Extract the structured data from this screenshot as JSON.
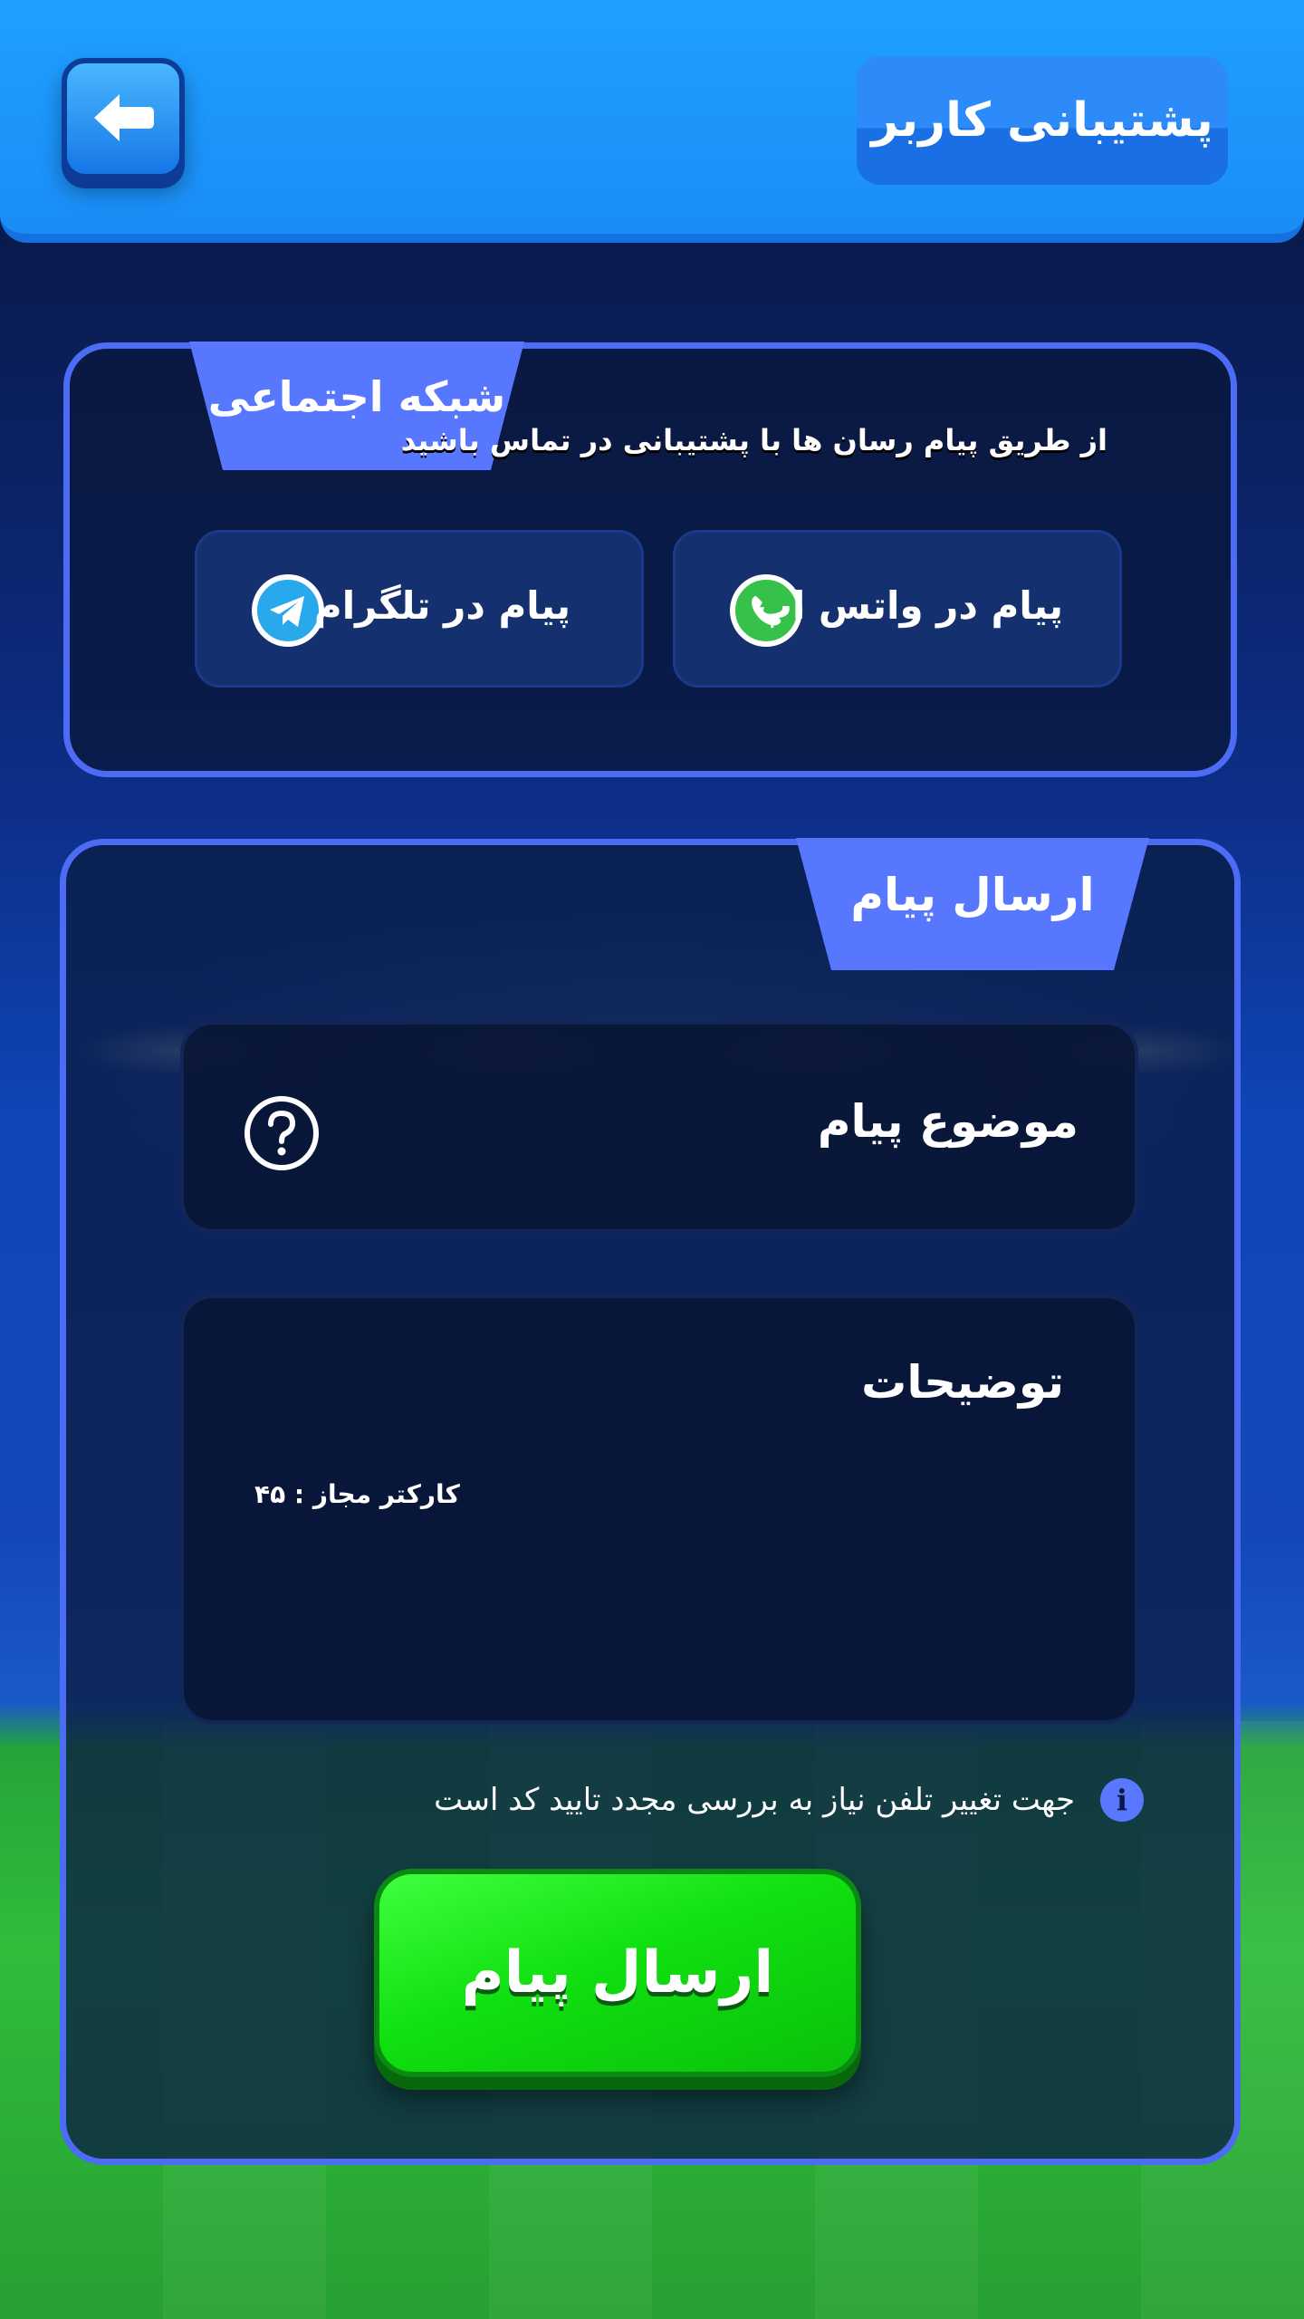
{
  "header": {
    "title": "پشتیبانی کاربر",
    "back_icon": "arrow-left-icon"
  },
  "social": {
    "tab_label": "شبکه اجتماعی",
    "description": "از طریق پیام رسان ها با پشتیبانی در تماس باشید",
    "telegram_label": "پیام در تلگرام",
    "telegram_icon": "telegram-icon",
    "whatsapp_label": "پیام در واتس اپ",
    "whatsapp_icon": "whatsapp-icon"
  },
  "send_message": {
    "tab_label": "ارسال پیام",
    "subject_label": "موضوع پیام",
    "subject_icon": "question-mark-icon",
    "description_label": "توضیحات",
    "char_counter": "کارکتر مجاز : ۴۵",
    "notice": "جهت تغییر تلفن نیاز به بررسی مجدد تایید کد است",
    "notice_icon": "info-icon",
    "submit_label": "ارسال پیام"
  },
  "colors": {
    "header_blue": "#1ea0ff",
    "panel_border": "#4d6cf5",
    "tab_fill": "#5777ff",
    "submit_green": "#10e010"
  }
}
